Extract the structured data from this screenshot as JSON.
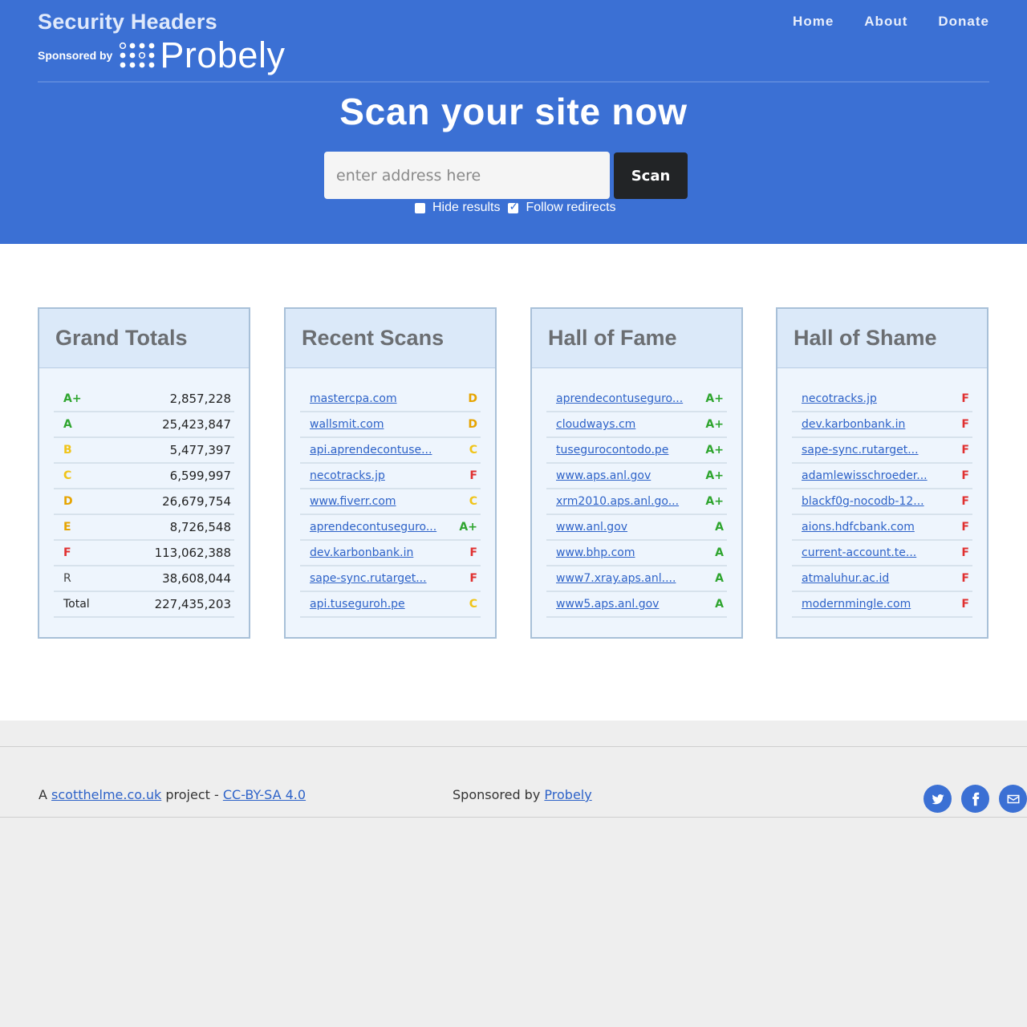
{
  "brand": {
    "title": "Security Headers",
    "sponsored_by": "Sponsored by",
    "sponsor_name": "Probely"
  },
  "nav": {
    "items": [
      "Home",
      "About",
      "Donate"
    ]
  },
  "hero": {
    "heading": "Scan your site now",
    "input_placeholder": "enter address here",
    "scan_label": "Scan",
    "hide_results_label": "Hide results",
    "hide_results_checked": false,
    "follow_redirects_label": "Follow redirects",
    "follow_redirects_checked": true
  },
  "colors": {
    "brand_blue": "#3b70d4",
    "grade_green": "#2fa52f",
    "grade_yellow": "#e6b200",
    "grade_red": "#e03030"
  },
  "grand_totals": {
    "title": "Grand Totals",
    "rows": [
      {
        "grade": "A+",
        "count": "2,857,228",
        "color": "#2fa52f"
      },
      {
        "grade": "A",
        "count": "25,423,847",
        "color": "#2fa52f"
      },
      {
        "grade": "B",
        "count": "5,477,397",
        "color": "#f0c419"
      },
      {
        "grade": "C",
        "count": "6,599,997",
        "color": "#f0c419"
      },
      {
        "grade": "D",
        "count": "26,679,754",
        "color": "#e6a400"
      },
      {
        "grade": "E",
        "count": "8,726,548",
        "color": "#e6a400"
      },
      {
        "grade": "F",
        "count": "113,062,388",
        "color": "#e03030"
      },
      {
        "grade": "R",
        "count": "38,608,044",
        "color": "#444444"
      },
      {
        "grade": "Total",
        "count": "227,435,203",
        "color": "#222222"
      }
    ]
  },
  "recent_scans": {
    "title": "Recent Scans",
    "rows": [
      {
        "site": "mastercpa.com",
        "grade": "D",
        "color": "#e6a400"
      },
      {
        "site": "wallsmit.com",
        "grade": "D",
        "color": "#e6a400"
      },
      {
        "site": "api.aprendecontuse...",
        "grade": "C",
        "color": "#f0c419"
      },
      {
        "site": "necotracks.jp",
        "grade": "F",
        "color": "#e03030"
      },
      {
        "site": "www.fiverr.com",
        "grade": "C",
        "color": "#f0c419"
      },
      {
        "site": "aprendecontuseguro...",
        "grade": "A+",
        "color": "#2fa52f"
      },
      {
        "site": "dev.karbonbank.in",
        "grade": "F",
        "color": "#e03030"
      },
      {
        "site": "sape-sync.rutarget...",
        "grade": "F",
        "color": "#e03030"
      },
      {
        "site": "api.tuseguroh.pe",
        "grade": "C",
        "color": "#f0c419"
      }
    ]
  },
  "hall_of_fame": {
    "title": "Hall of Fame",
    "rows": [
      {
        "site": "aprendecontuseguro...",
        "grade": "A+",
        "color": "#2fa52f"
      },
      {
        "site": "cloudways.cm",
        "grade": "A+",
        "color": "#2fa52f"
      },
      {
        "site": "tusegurocontodo.pe",
        "grade": "A+",
        "color": "#2fa52f"
      },
      {
        "site": "www.aps.anl.gov",
        "grade": "A+",
        "color": "#2fa52f"
      },
      {
        "site": "xrm2010.aps.anl.go...",
        "grade": "A+",
        "color": "#2fa52f"
      },
      {
        "site": "www.anl.gov",
        "grade": "A",
        "color": "#2fa52f"
      },
      {
        "site": "www.bhp.com",
        "grade": "A",
        "color": "#2fa52f"
      },
      {
        "site": "www7.xray.aps.anl....",
        "grade": "A",
        "color": "#2fa52f"
      },
      {
        "site": "www5.aps.anl.gov",
        "grade": "A",
        "color": "#2fa52f"
      }
    ]
  },
  "hall_of_shame": {
    "title": "Hall of Shame",
    "rows": [
      {
        "site": "necotracks.jp",
        "grade": "F",
        "color": "#e03030"
      },
      {
        "site": "dev.karbonbank.in",
        "grade": "F",
        "color": "#e03030"
      },
      {
        "site": "sape-sync.rutarget...",
        "grade": "F",
        "color": "#e03030"
      },
      {
        "site": "adamlewisschroeder...",
        "grade": "F",
        "color": "#e03030"
      },
      {
        "site": "blackf0g-nocodb-12...",
        "grade": "F",
        "color": "#e03030"
      },
      {
        "site": "aions.hdfcbank.com",
        "grade": "F",
        "color": "#e03030"
      },
      {
        "site": "current-account.te...",
        "grade": "F",
        "color": "#e03030"
      },
      {
        "site": "atmaluhur.ac.id",
        "grade": "F",
        "color": "#e03030"
      },
      {
        "site": "modernmingle.com",
        "grade": "F",
        "color": "#e03030"
      }
    ]
  },
  "footer": {
    "prefix": "A",
    "site_link": "scotthelme.co.uk",
    "middle": "project -",
    "license_link": "CC-BY-SA 4.0",
    "sponsored_text": "Sponsored by",
    "sponsor_link": "Probely",
    "social": [
      "twitter-icon",
      "facebook-icon",
      "email-icon"
    ]
  }
}
